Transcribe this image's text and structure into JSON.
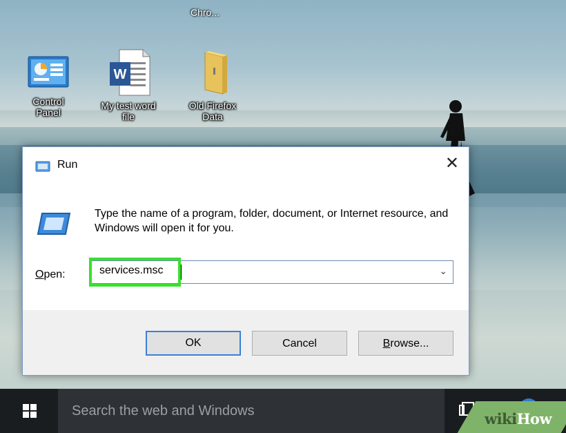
{
  "desktop": {
    "top_label": "Chro...",
    "icons": [
      {
        "name": "control-panel",
        "label_line1": "Control",
        "label_line2": "Panel"
      },
      {
        "name": "word-doc",
        "label_line1": "My test word",
        "label_line2": "file"
      },
      {
        "name": "folder",
        "label_line1": "Old Firefox",
        "label_line2": "Data"
      }
    ]
  },
  "run_dialog": {
    "title": "Run",
    "close_glyph": "✕",
    "description": "Type the name of a program, folder, document, or Internet resource, and Windows will open it for you.",
    "open_label": "Open:",
    "open_value": "services.msc",
    "dropdown_glyph": "⌄",
    "buttons": {
      "ok": "OK",
      "cancel": "Cancel",
      "browse": "Browse..."
    }
  },
  "taskbar": {
    "search_placeholder": "Search the web and Windows"
  },
  "watermark": {
    "part1": "wiki",
    "part2": "How"
  },
  "colors": {
    "highlight": "#39e02d",
    "ok_border": "#3c7fd6",
    "taskbar": "#1a1d20",
    "wikihow_green": "#7fb369"
  }
}
